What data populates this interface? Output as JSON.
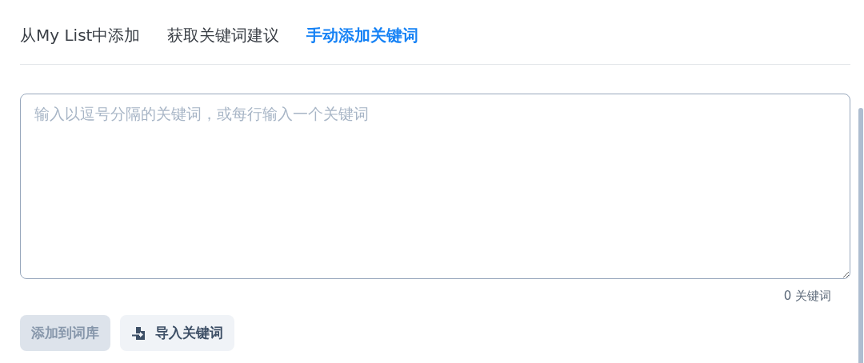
{
  "tabs": [
    {
      "label": "从My List中添加",
      "selected": false
    },
    {
      "label": "获取关键词建议",
      "selected": false
    },
    {
      "label": "手动添加关键词",
      "selected": true
    }
  ],
  "keyword_input": {
    "placeholder": "输入以逗号分隔的关键词，或每行输入一个关键词"
  },
  "keyword_count": "0 关键词",
  "buttons": [
    {
      "label": "添加到词库",
      "kind": "plain",
      "disabled": true
    },
    {
      "label": "导入关键词",
      "kind": "import",
      "disabled": false
    }
  ]
}
